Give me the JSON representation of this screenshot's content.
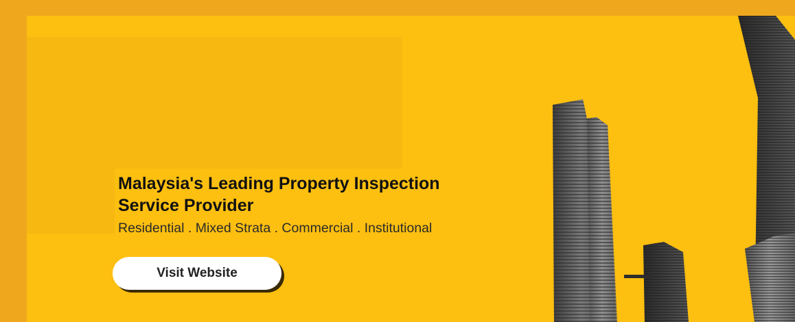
{
  "banner": {
    "headline": "Malaysia's Leading Property Inspection Service Provider",
    "tagline": "Residential . Mixed Strata . Commercial . Institutional",
    "cta_label": "Visit Website"
  },
  "colors": {
    "frame": "#efa81e",
    "banner_background": "#fdbf10",
    "button_background": "#ffffff",
    "button_text": "#222222"
  },
  "icons": {
    "city_artwork": "skyscrapers-image"
  }
}
